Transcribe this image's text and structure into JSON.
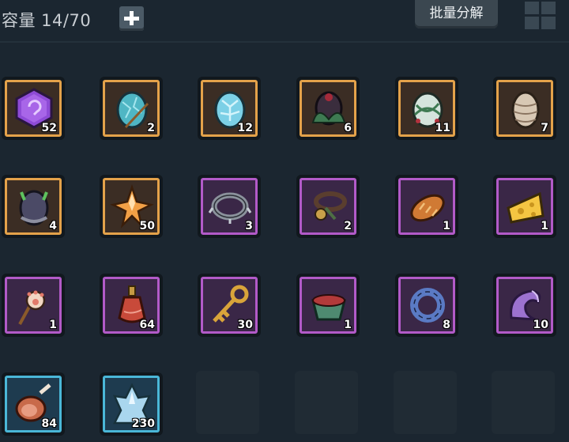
{
  "header": {
    "capacity_label": "容量 14/70",
    "add_icon": "plus-icon",
    "batch_decompose_label": "批量分解",
    "grid_icon": "grid-view-icon"
  },
  "inventory": {
    "slots": [
      {
        "name": "purple-gem",
        "icon": "purple-rune-gem-icon",
        "count": "52",
        "rarity": "orange"
      },
      {
        "name": "teal-egg",
        "icon": "teal-egg-icon",
        "count": "2",
        "rarity": "orange"
      },
      {
        "name": "ice-egg",
        "icon": "ice-egg-icon",
        "count": "12",
        "rarity": "orange"
      },
      {
        "name": "dark-leaf-egg",
        "icon": "dark-leaf-egg-icon",
        "count": "6",
        "rarity": "orange"
      },
      {
        "name": "vine-egg",
        "icon": "vine-egg-icon",
        "count": "11",
        "rarity": "orange"
      },
      {
        "name": "scaled-egg",
        "icon": "scaled-egg-icon",
        "count": "7",
        "rarity": "orange"
      },
      {
        "name": "horned-egg",
        "icon": "horned-egg-icon",
        "count": "4",
        "rarity": "orange"
      },
      {
        "name": "star-crystal",
        "icon": "orange-crystal-icon",
        "count": "50",
        "rarity": "orange"
      },
      {
        "name": "spiked-collar",
        "icon": "spiked-collar-icon",
        "count": "3",
        "rarity": "purple"
      },
      {
        "name": "pet-collar",
        "icon": "pet-collar-icon",
        "count": "2",
        "rarity": "purple"
      },
      {
        "name": "bread",
        "icon": "bread-icon",
        "count": "1",
        "rarity": "purple"
      },
      {
        "name": "cheese",
        "icon": "cheese-icon",
        "count": "1",
        "rarity": "purple"
      },
      {
        "name": "paw-toy",
        "icon": "paw-wand-icon",
        "count": "1",
        "rarity": "purple"
      },
      {
        "name": "potion",
        "icon": "potion-bottle-icon",
        "count": "64",
        "rarity": "purple"
      },
      {
        "name": "golden-key",
        "icon": "golden-key-icon",
        "count": "30",
        "rarity": "purple"
      },
      {
        "name": "food-bowl",
        "icon": "food-bowl-icon",
        "count": "1",
        "rarity": "purple"
      },
      {
        "name": "blue-ring",
        "icon": "blue-ring-icon",
        "count": "8",
        "rarity": "purple"
      },
      {
        "name": "purple-claw",
        "icon": "purple-claw-icon",
        "count": "10",
        "rarity": "purple"
      },
      {
        "name": "meat",
        "icon": "meat-icon",
        "count": "84",
        "rarity": "cyan"
      },
      {
        "name": "ice-shard",
        "icon": "ice-shard-icon",
        "count": "230",
        "rarity": "cyan"
      }
    ],
    "empty_slots": 4
  },
  "colors": {
    "background": "#1b2630",
    "rarity_orange": "#e4a24a",
    "rarity_purple": "#b25ac8",
    "rarity_cyan": "#4ab7d8"
  }
}
